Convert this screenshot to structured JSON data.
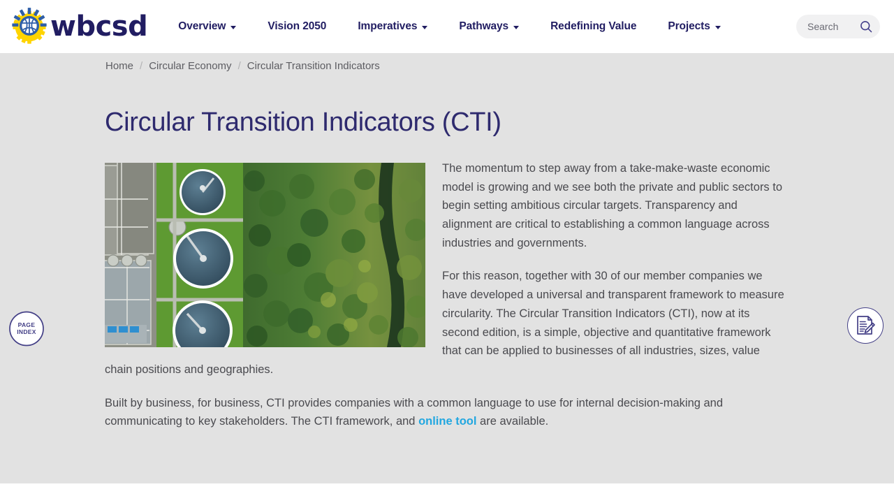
{
  "header": {
    "brand": {
      "wordmark": "wbcsd",
      "logo_icon": "wbcsd-globe-gear-logo"
    },
    "nav": [
      {
        "label": "Overview",
        "has_dropdown": true
      },
      {
        "label": "Vision 2050",
        "has_dropdown": false
      },
      {
        "label": "Imperatives",
        "has_dropdown": true
      },
      {
        "label": "Pathways",
        "has_dropdown": true
      },
      {
        "label": "Redefining Value",
        "has_dropdown": false
      },
      {
        "label": "Projects",
        "has_dropdown": true
      }
    ],
    "search": {
      "placeholder": "Search",
      "value": "",
      "icon": "search-icon"
    }
  },
  "breadcrumb": {
    "items": [
      "Home",
      "Circular Economy",
      "Circular Transition Indicators"
    ],
    "separator": "/"
  },
  "main": {
    "title": "Circular Transition Indicators (CTI)",
    "hero_image": {
      "alt": "Aerial view of a circular wastewater treatment plant beside a forest",
      "icon": "aerial-photo"
    },
    "paragraphs": {
      "p1": "The momentum to step away from a take-make-waste economic model is growing and we see both the private and public sectors to begin setting ambitious circular targets. Transparency and alignment are critical to establishing a common language across industries and governments.",
      "p2": "For this reason, together with 30 of our member companies we have developed a universal and transparent framework to measure circularity. The Circular Transition Indicators (CTI), now at its second edition, is a simple, objective and quantitative framework that can be applied to businesses of all industries, sizes, value chain positions and geographies.",
      "p3_before_link": "Built by business, for business, CTI provides companies with a common language to use for internal decision-making and communicating to key stakeholders. The CTI framework, and ",
      "p3_link": "online tool",
      "p3_after_link": " are available."
    }
  },
  "widgets": {
    "page_index": {
      "line1": "PAGE",
      "line2": "INDEX",
      "expand_icon": "chevron-right-icon"
    },
    "feedback": {
      "icon": "document-pencil-icon"
    }
  },
  "colors": {
    "brand_navy": "#211d62",
    "title_indigo": "#2e2a6e",
    "link_cyan": "#22a7e0",
    "body_gray": "#e2e2e2",
    "text_gray": "#4a4a4f",
    "logo_yellow": "#ffd400",
    "logo_blue": "#2f5fa8"
  }
}
